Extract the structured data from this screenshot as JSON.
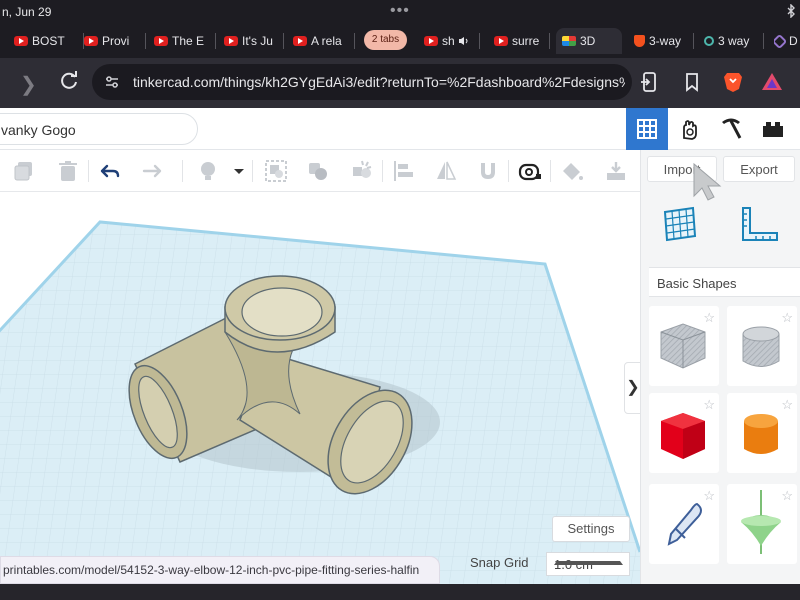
{
  "status_bar": {
    "time": "n, Jun 29",
    "dots": "•••",
    "bluetooth_icon": "bluetooth-icon"
  },
  "tabs": [
    {
      "title": "BOST",
      "icon": "youtube-icon"
    },
    {
      "title": "Provi",
      "icon": "youtube-icon"
    },
    {
      "title": "The E",
      "icon": "youtube-icon"
    },
    {
      "title": "It's Ju",
      "icon": "youtube-icon"
    },
    {
      "title": "A rela",
      "icon": "youtube-icon"
    },
    {
      "title": "sh",
      "icon": "youtube-icon"
    },
    {
      "title": "surre",
      "icon": "youtube-icon"
    },
    {
      "title": "3D",
      "icon": "tinkercad-icon"
    },
    {
      "title": "3-way",
      "icon": "brave-shield-icon"
    },
    {
      "title": "3 way",
      "icon": "search-icon"
    },
    {
      "title": "D",
      "icon": "hexagon-icon"
    }
  ],
  "tab_group_label": "2 tabs",
  "address_bar": {
    "url": "tinkercad.com/things/kh2GYgEdAi3/edit?returnTo=%2Fdashboard%2Fdesigns%"
  },
  "design": {
    "name": "vanky Gogo"
  },
  "panel": {
    "import_label": "Import",
    "export_label": "Export",
    "section_title": "Basic Shapes",
    "shapes": [
      {
        "name": "Box (hole)",
        "color": "#b6bcc4"
      },
      {
        "name": "Cylinder (hole)",
        "color": "#b6bcc4"
      },
      {
        "name": "Box",
        "color": "#e2001a"
      },
      {
        "name": "Cylinder",
        "color": "#f28a17"
      },
      {
        "name": "Scribble",
        "color": "#5b7fbf"
      },
      {
        "name": "Spinning Top",
        "color": "#8ed38a"
      }
    ]
  },
  "workplane": {
    "settings_label": "Settings",
    "snap_grid_label": "Snap Grid",
    "snap_grid_value": "1.0 cm",
    "model_color": "#cbc5a2"
  },
  "link_preview": "printables.com/model/54152-3-way-elbow-12-inch-pvc-pipe-fitting-series-halfin",
  "collapse_icon": "chevron-right-icon"
}
